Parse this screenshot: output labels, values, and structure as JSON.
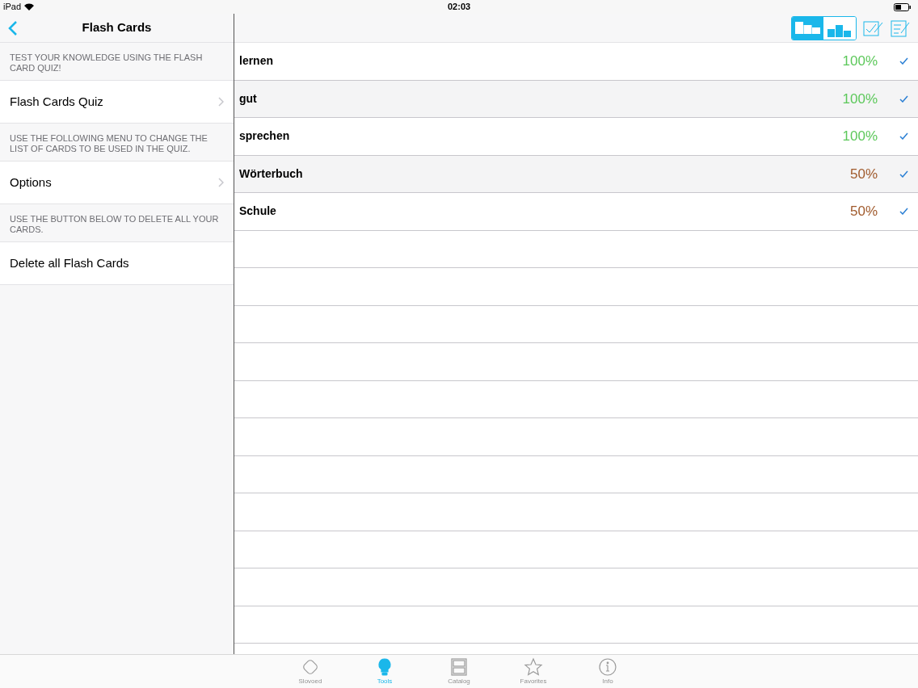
{
  "status_bar": {
    "device": "iPad",
    "time": "02:03"
  },
  "sidebar": {
    "title": "Flash Cards",
    "sections": [
      {
        "note": "TEST YOUR KNOWLEDGE USING THE FLASH CARD QUIZ!",
        "item": {
          "label": "Flash Cards Quiz",
          "kind": "link"
        }
      },
      {
        "note": "USE THE FOLLOWING MENU TO CHANGE THE LIST OF CARDS TO BE USED IN THE QUIZ.",
        "item": {
          "label": "Options",
          "kind": "link"
        }
      },
      {
        "note": "USE THE BUTTON BELOW TO DELETE ALL YOUR CARDS.",
        "item": {
          "label": "Delete all Flash Cards",
          "kind": "action"
        }
      }
    ]
  },
  "toolbar": {
    "sort": [
      {
        "kind": "alphabetical",
        "selected": true
      },
      {
        "kind": "ranking",
        "selected": false
      }
    ]
  },
  "cards": [
    {
      "word": "lernen",
      "score": "100%",
      "color": "#5cc85a",
      "checked": true
    },
    {
      "word": "gut",
      "score": "100%",
      "color": "#5cc85a",
      "checked": true
    },
    {
      "word": "sprechen",
      "score": "100%",
      "color": "#5cc85a",
      "checked": true
    },
    {
      "word": "Wörterbuch",
      "score": "50%",
      "color": "#a05a2c",
      "checked": true
    },
    {
      "word": "Schule",
      "score": "50%",
      "color": "#a05a2c",
      "checked": true
    }
  ],
  "tab_bar": [
    {
      "label": "Slovoed",
      "kind": "diamond",
      "selected": false
    },
    {
      "label": "Tools",
      "kind": "bulb",
      "selected": true
    },
    {
      "label": "Catalog",
      "kind": "cabinet",
      "selected": false
    },
    {
      "label": "Favorites",
      "kind": "star",
      "selected": false
    },
    {
      "label": "Info",
      "kind": "info",
      "selected": false
    }
  ]
}
